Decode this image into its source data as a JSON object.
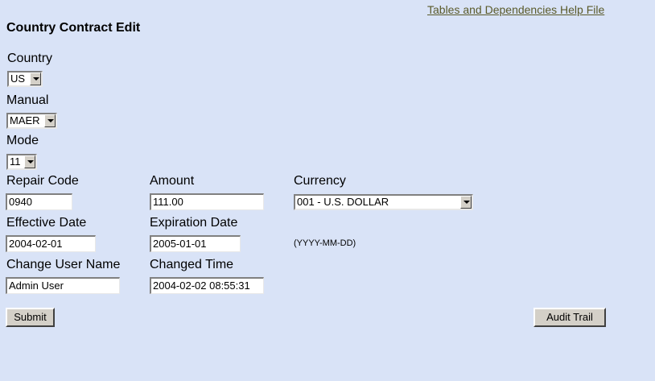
{
  "header": {
    "help_link": "Tables and Dependencies Help File",
    "title": "Country Contract Edit"
  },
  "country": {
    "label": "Country",
    "value": "US"
  },
  "manual": {
    "label": "Manual",
    "value": "MAER"
  },
  "mode": {
    "label": "Mode",
    "value": "11"
  },
  "repair_code": {
    "label": "Repair Code",
    "value": "0940"
  },
  "amount": {
    "label": "Amount",
    "value": "111.00"
  },
  "currency": {
    "label": "Currency",
    "value": "001 - U.S. DOLLAR"
  },
  "effective_date": {
    "label": "Effective Date",
    "value": "2004-02-01"
  },
  "expiration_date": {
    "label": "Expiration Date",
    "value": "2005-01-01"
  },
  "date_format_hint": "(YYYY-MM-DD)",
  "change_user": {
    "label": "Change User Name",
    "value": "Admin User"
  },
  "changed_time": {
    "label": "Changed Time",
    "value": "2004-02-02 08:55:31"
  },
  "buttons": {
    "submit": "Submit",
    "audit_trail": "Audit Trail"
  },
  "icons": {
    "dropdown": "chevron-down-icon"
  },
  "colors": {
    "background": "#d9e3f7",
    "link": "#5a5a2a",
    "button": "#d4d0c8"
  }
}
